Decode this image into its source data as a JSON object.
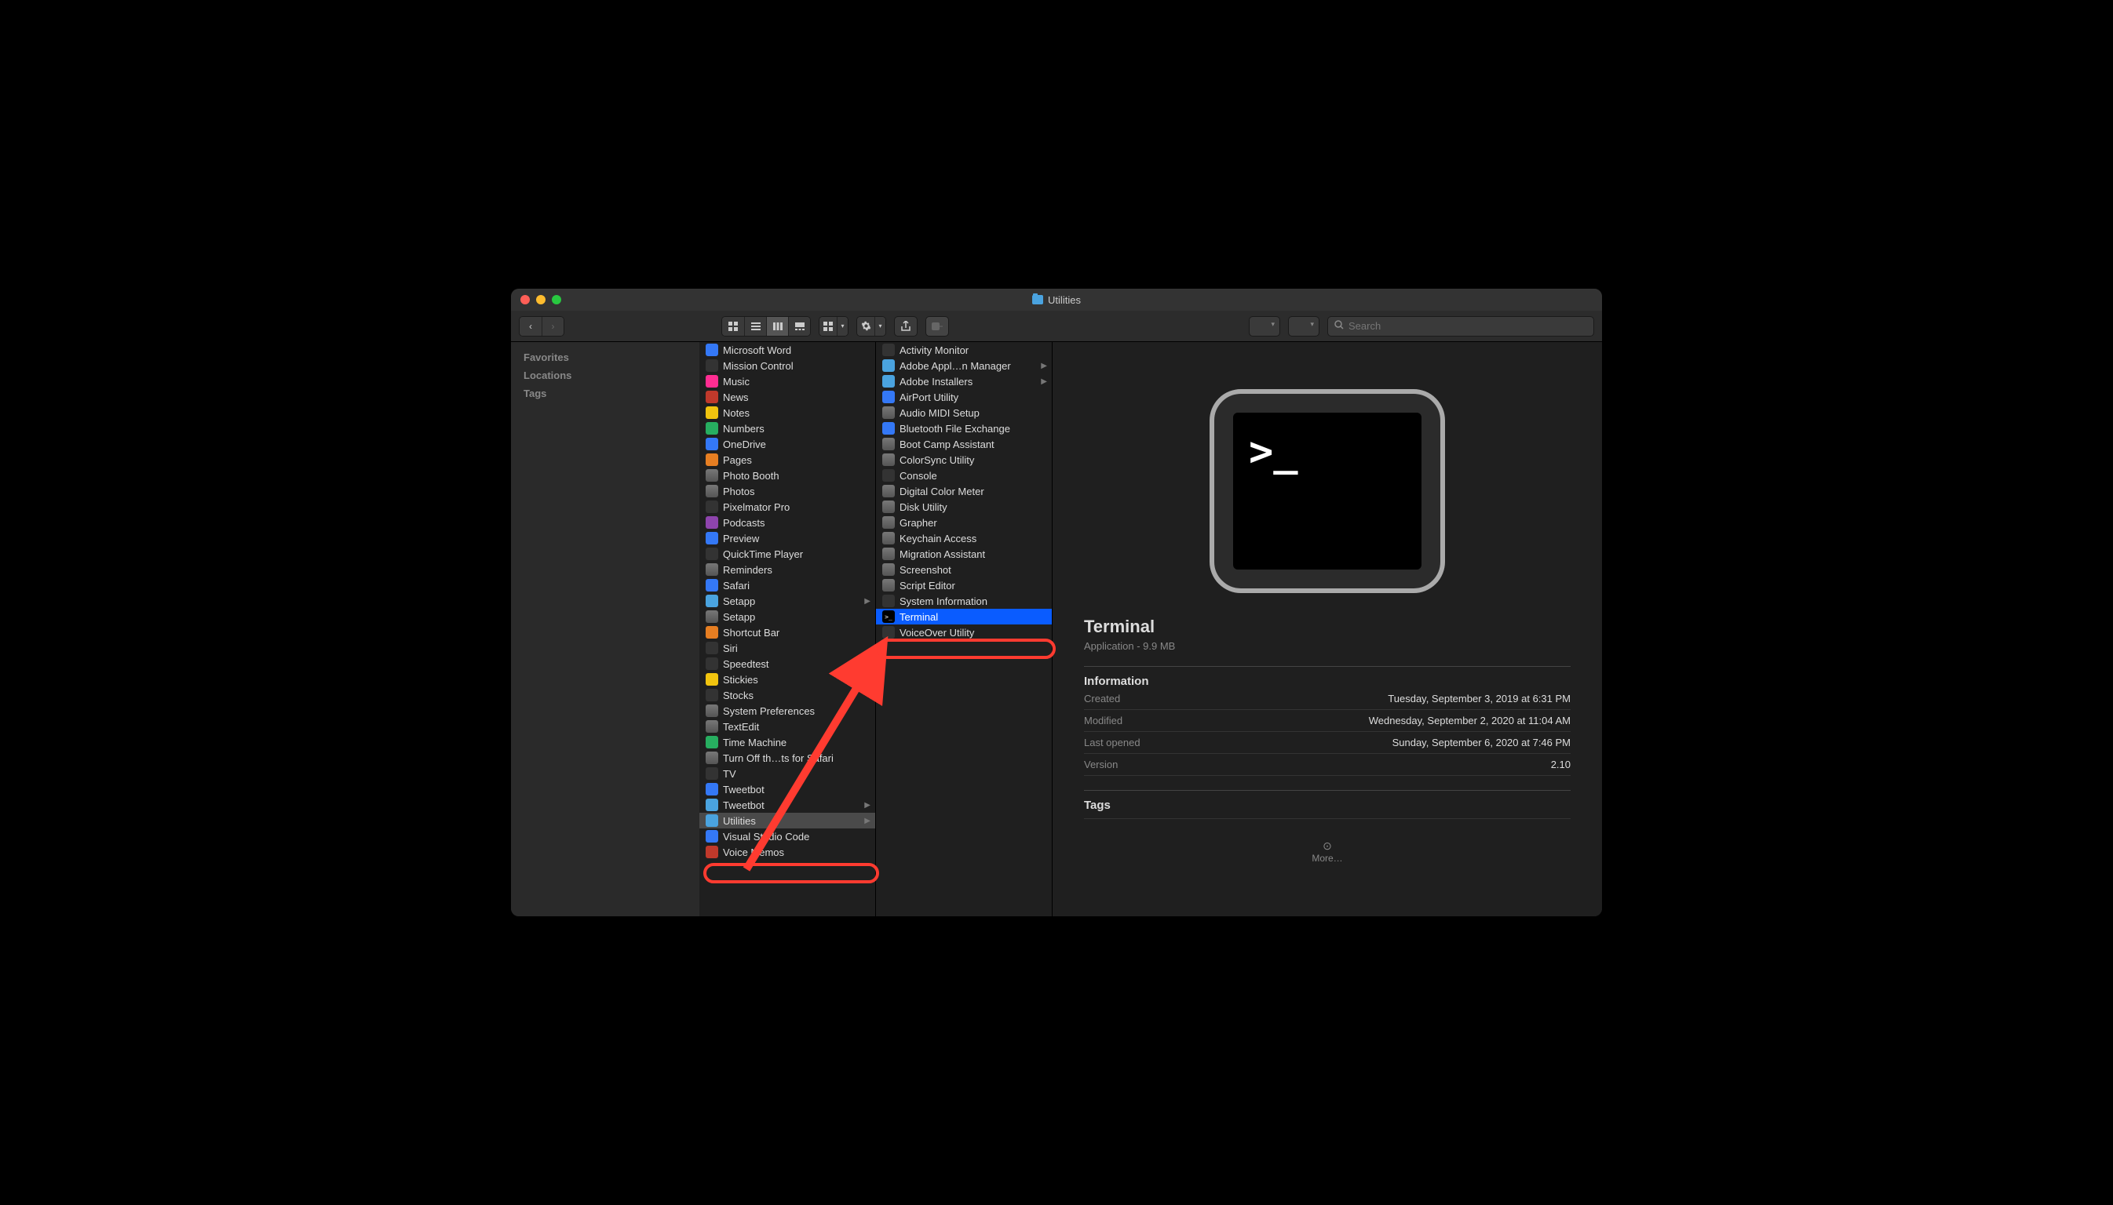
{
  "title": "Utilities",
  "sidebar": {
    "favorites": "Favorites",
    "locations": "Locations",
    "tags": "Tags"
  },
  "search": {
    "placeholder": "Search"
  },
  "col1": [
    {
      "label": "Microsoft Word",
      "icon": "blue"
    },
    {
      "label": "Mission Control",
      "icon": "dark"
    },
    {
      "label": "Music",
      "icon": "pink"
    },
    {
      "label": "News",
      "icon": "red"
    },
    {
      "label": "Notes",
      "icon": "yellow"
    },
    {
      "label": "Numbers",
      "icon": "green"
    },
    {
      "label": "OneDrive",
      "icon": "blue"
    },
    {
      "label": "Pages",
      "icon": "orange"
    },
    {
      "label": "Photo Booth",
      "icon": "app"
    },
    {
      "label": "Photos",
      "icon": "app"
    },
    {
      "label": "Pixelmator Pro",
      "icon": "dark"
    },
    {
      "label": "Podcasts",
      "icon": "purple"
    },
    {
      "label": "Preview",
      "icon": "blue"
    },
    {
      "label": "QuickTime Player",
      "icon": "dark"
    },
    {
      "label": "Reminders",
      "icon": "app"
    },
    {
      "label": "Safari",
      "icon": "blue"
    },
    {
      "label": "Setapp",
      "icon": "folder",
      "chev": true
    },
    {
      "label": "Setapp",
      "icon": "app"
    },
    {
      "label": "Shortcut Bar",
      "icon": "orange"
    },
    {
      "label": "Siri",
      "icon": "dark"
    },
    {
      "label": "Speedtest",
      "icon": "dark"
    },
    {
      "label": "Stickies",
      "icon": "yellow"
    },
    {
      "label": "Stocks",
      "icon": "dark"
    },
    {
      "label": "System Preferences",
      "icon": "app"
    },
    {
      "label": "TextEdit",
      "icon": "app"
    },
    {
      "label": "Time Machine",
      "icon": "green"
    },
    {
      "label": "Turn Off th…ts for Safari",
      "icon": "app"
    },
    {
      "label": "TV",
      "icon": "dark"
    },
    {
      "label": "Tweetbot",
      "icon": "blue"
    },
    {
      "label": "Tweetbot",
      "icon": "folder",
      "chev": true
    },
    {
      "label": "Utilities",
      "icon": "folder",
      "chev": true,
      "sel": "dim"
    },
    {
      "label": "Visual Studio Code",
      "icon": "blue"
    },
    {
      "label": "Voice Memos",
      "icon": "red"
    }
  ],
  "col2": [
    {
      "label": "Activity Monitor",
      "icon": "dark"
    },
    {
      "label": "Adobe Appl…n Manager",
      "icon": "folder",
      "chev": true
    },
    {
      "label": "Adobe Installers",
      "icon": "folder",
      "chev": true
    },
    {
      "label": "AirPort Utility",
      "icon": "blue"
    },
    {
      "label": "Audio MIDI Setup",
      "icon": "app"
    },
    {
      "label": "Bluetooth File Exchange",
      "icon": "blue"
    },
    {
      "label": "Boot Camp Assistant",
      "icon": "app"
    },
    {
      "label": "ColorSync Utility",
      "icon": "app"
    },
    {
      "label": "Console",
      "icon": "dark"
    },
    {
      "label": "Digital Color Meter",
      "icon": "app"
    },
    {
      "label": "Disk Utility",
      "icon": "app"
    },
    {
      "label": "Grapher",
      "icon": "app"
    },
    {
      "label": "Keychain Access",
      "icon": "app"
    },
    {
      "label": "Migration Assistant",
      "icon": "app"
    },
    {
      "label": "Screenshot",
      "icon": "app"
    },
    {
      "label": "Script Editor",
      "icon": "app"
    },
    {
      "label": "System Information",
      "icon": "dark"
    },
    {
      "label": "Terminal",
      "icon": "term",
      "sel": "sel"
    },
    {
      "label": "VoiceOver Utility",
      "icon": "dark"
    }
  ],
  "preview": {
    "name": "Terminal",
    "sub": "Application - 9.9 MB",
    "info_label": "Information",
    "tags_label": "Tags",
    "more": "More…",
    "rows": [
      {
        "k": "Created",
        "v": "Tuesday, September 3, 2019 at 6:31 PM"
      },
      {
        "k": "Modified",
        "v": "Wednesday, September 2, 2020 at 11:04 AM"
      },
      {
        "k": "Last opened",
        "v": "Sunday, September 6, 2020 at 7:46 PM"
      },
      {
        "k": "Version",
        "v": "2.10"
      }
    ]
  }
}
